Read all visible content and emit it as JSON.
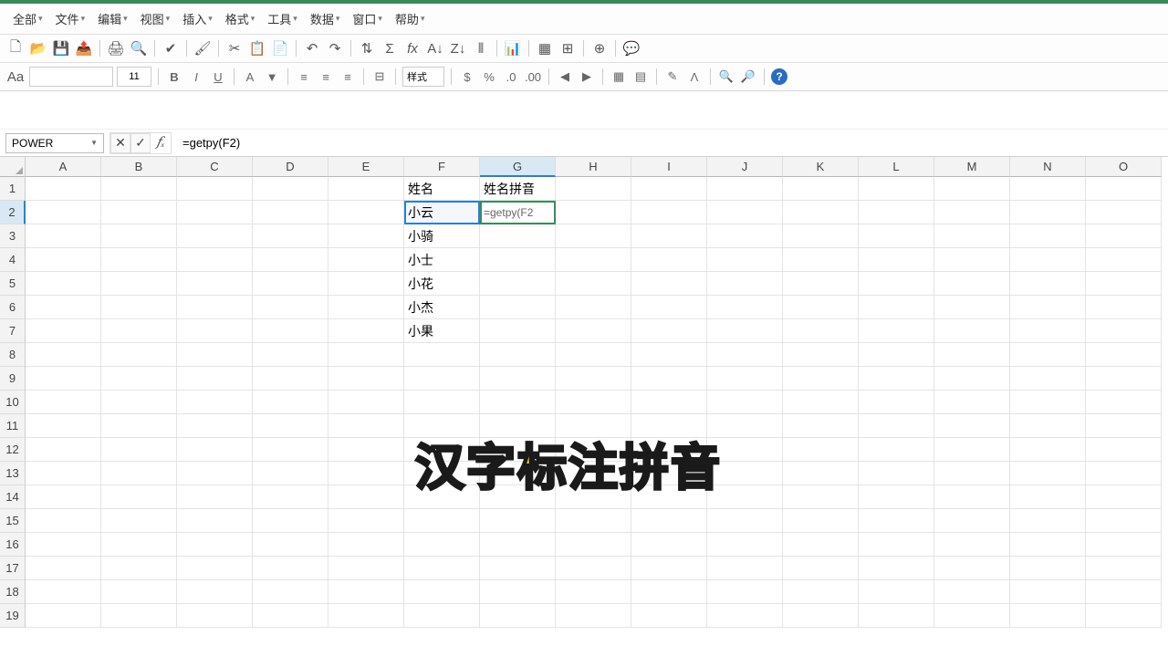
{
  "menu": [
    "全部",
    "文件",
    "编辑",
    "视图",
    "插入",
    "格式",
    "工具",
    "数据",
    "窗口",
    "帮助"
  ],
  "name_box": "POWER",
  "formula": "=getpy(F2)",
  "font_size": "11",
  "para_label": "样式",
  "columns": [
    "A",
    "B",
    "C",
    "D",
    "E",
    "F",
    "G",
    "H",
    "I",
    "J",
    "K",
    "L",
    "M",
    "N",
    "O"
  ],
  "rows": [
    "1",
    "2",
    "3",
    "4",
    "5",
    "6",
    "7",
    "8",
    "9",
    "10",
    "11",
    "12",
    "13",
    "14",
    "15",
    "16",
    "17",
    "18",
    "19"
  ],
  "active_col": "G",
  "active_row": "2",
  "ref_cell": {
    "col": "F",
    "row": "2"
  },
  "cell_data": {
    "F1": "姓名",
    "G1": "姓名拼音",
    "F2": "小云",
    "G2": "=getpy(F2",
    "F3": "小骑",
    "F4": "小士",
    "F5": "小花",
    "F6": "小杰",
    "F7": "小果"
  },
  "overlay": "汉字标注拼音",
  "icons": {
    "new": "🗋",
    "open": "📂",
    "save": "💾",
    "export": "📤",
    "print": "🖨",
    "preview": "🔍",
    "cut": "✂",
    "copy": "📋",
    "paste": "📄",
    "brush": "🖌",
    "undo": "↶",
    "redo": "↷",
    "sort": "⇅",
    "sum": "Σ",
    "fx": "fx",
    "chart": "📊",
    "filter": "⫴",
    "sortaz": "A↓",
    "pivot": "▦",
    "image": "🖼",
    "link": "🔗",
    "draw": "✎",
    "find": "🔍",
    "help": "?",
    "cancel": "✕",
    "accept": "✓"
  }
}
